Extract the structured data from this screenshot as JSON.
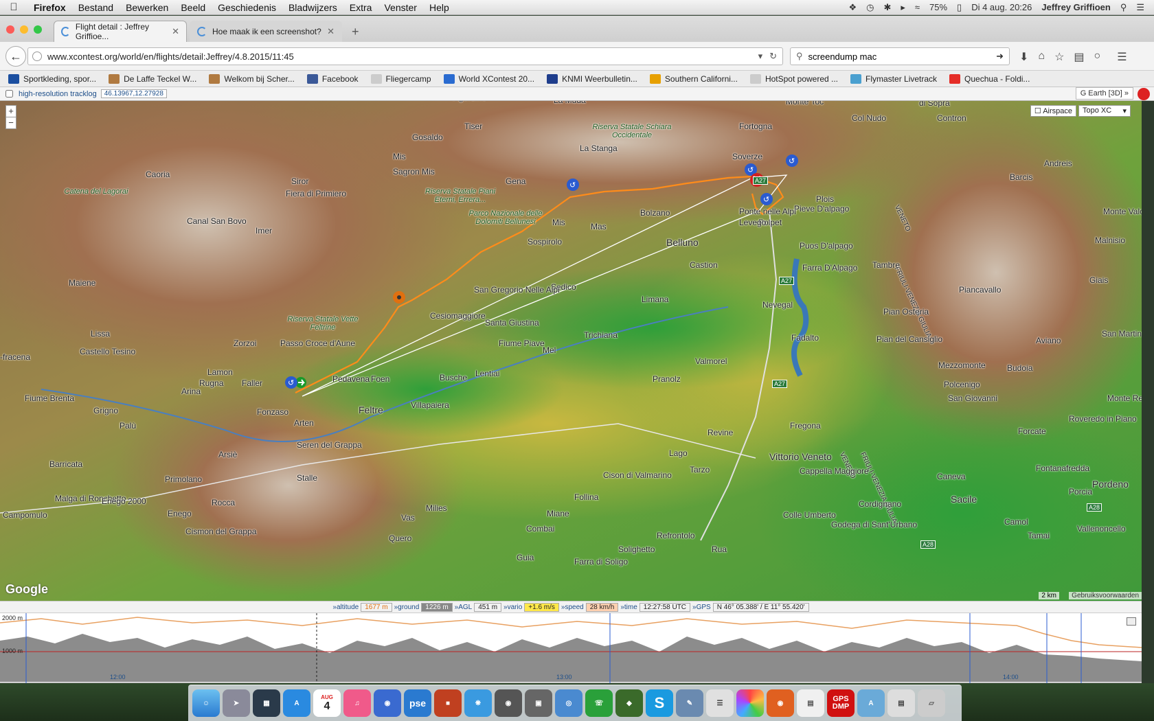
{
  "menubar": {
    "app": "Firefox",
    "items": [
      "Bestand",
      "Bewerken",
      "Beeld",
      "Geschiedenis",
      "Bladwijzers",
      "Extra",
      "Venster",
      "Help"
    ],
    "battery": "75%",
    "datetime": "Di 4 aug.  20:26",
    "user": "Jeffrey Griffioen"
  },
  "tabs": [
    {
      "title": "Flight detail : Jeffrey Griffioe...",
      "active": true
    },
    {
      "title": "Hoe maak ik een screenshot?",
      "active": false
    }
  ],
  "nav": {
    "url": "www.xcontest.org/world/en/flights/detail:Jeffrey/4.8.2015/11:45",
    "search": "screendump mac"
  },
  "bookmarks": [
    {
      "label": "Sportkleding, spor...",
      "color": "#1b4fa0"
    },
    {
      "label": "De Laffe Teckel W...",
      "color": "#b07a40"
    },
    {
      "label": "Welkom bij Scher...",
      "color": "#b07a40"
    },
    {
      "label": "Facebook",
      "color": "#3b5998"
    },
    {
      "label": "Fliegercamp",
      "color": "#cccccc"
    },
    {
      "label": "World XContest 20...",
      "color": "#2a6bd0"
    },
    {
      "label": "KNMI Weerbulletin...",
      "color": "#1e3d8c"
    },
    {
      "label": "Southern Californi...",
      "color": "#e7a000"
    },
    {
      "label": "HotSpot powered ...",
      "color": "#cccccc"
    },
    {
      "label": "Flymaster Livetrack",
      "color": "#4aa0d0"
    },
    {
      "label": "Quechua - Foldi...",
      "color": "#e52d27"
    }
  ],
  "toolstrip": {
    "checkbox_label": "high-resolution tracklog",
    "coords": "46.13967,12.27928",
    "gearth": "G Earth [3D] »"
  },
  "map": {
    "airspace": "Airspace",
    "layer": "Topo XC",
    "google": "Google",
    "scale": "2 km",
    "terms": "Gebruiksvoorwaarden",
    "zoom_in": "+",
    "zoom_out": "−",
    "labels": {
      "agordino": "Agordino",
      "la_muda": "La Muda",
      "monte_toc": "Monte Toc",
      "col_nudo": "Col Nudo",
      "di_sopra": "di Sopra",
      "contron": "Contron",
      "tiser": "Tiser",
      "gosaldo": "Gosaldo",
      "riserva_schiara": "Riserva Statale Schiara Occidentale",
      "la_stanga": "La Stanga",
      "fortogna": "Fortogna",
      "soverzene": "Soverze",
      "caoria": "Caoria",
      "mis": "Mis",
      "sagron_mis": "Sagron Mis",
      "siror": "Siror",
      "fiera": "Fiera di Primiero",
      "gena": "Gena",
      "riserva_piani": "Riserva Statale Piani Eterni, Errera...",
      "catena": "Catena del Lagorai",
      "canal": "Canal San Bovo",
      "imer": "Imer",
      "parco": "Parco Nazionale delle Dolomiti Bellunesi",
      "mis2": "Mis",
      "mas": "Mas",
      "bolzano": "Bolzano",
      "plois": "Plois",
      "pieve": "Pieve D'alpago",
      "barcis": "Barcis",
      "andreis": "Andreis",
      "friuli1": "FRIULI-VENEZIA GIULIA",
      "veneto1": "VENETO",
      "ponte": "Ponte nelle Alpi",
      "polpet": "Polpet",
      "levego": "Levego",
      "sospirolo": "Sospirolo",
      "belluno": "Belluno",
      "puos": "Puos D'alpago",
      "malnisio": "Malnisio",
      "montereale": "Monte Valcel",
      "maiene": "Maiene",
      "castion": "Castion",
      "farra": "Farra D'Alpago",
      "tambre": "Tambre",
      "sedico": "Sedico",
      "san_gregorio": "San Gregorio Nelle Alpi",
      "giais": "Giais",
      "piancavallo": "Piancavallo",
      "limana": "Limana",
      "nevegal": "Nevegal",
      "pian_osteria": "Pian Osteria",
      "lissa": "Lissa",
      "riserva_vette": "Riserva Statale Vette Feltrine",
      "cesiomaggiore": "Cesiomaggiore",
      "santa_giustina": "Santa Giustina",
      "trichiana": "Trichiana",
      "fadalto": "Fadalto",
      "pian_cansiglio": "Pian del Cansiglio",
      "aviano": "Aviano",
      "san_martino": "San Martino di Campagna",
      "castello_tesino": "Castello Tesino",
      "zorzoi": "Zorzoi",
      "passo_croce": "Passo Croce d'Aune",
      "fiume_piave": "Fiume Piave",
      "mel": "Mel",
      "valmorel": "Valmorel",
      "fracena": "-fracena",
      "lamon": "Lamon",
      "rugna": "Rugna",
      "faller": "Faller",
      "pedavena": "Pedavena",
      "foen": "Foen",
      "lentiai": "Lentiai",
      "busche": "Busche",
      "pranolz": "Pranolz",
      "mezzomonte": "Mezzomonte",
      "budoia": "Budoia",
      "polcenigo": "Polcenigo",
      "arina": "Arina",
      "fiume_brenta": "Fiume Brenta",
      "grigno": "Grigno",
      "fonzaso": "Fonzaso",
      "feltre": "Feltre",
      "villapaiera": "Villapaiera",
      "san_giovanni": "San Giovanni",
      "monte_reale": "Monte Re",
      "palu": "Palù",
      "arten": "Arten",
      "fregona": "Fregona",
      "friuli2": "FRIULI-VENEZIA GIULIA",
      "veneto2": "VENETO",
      "forcate": "Forcate",
      "roveredo": "Roveredo in Piano",
      "arsie": "Arsiè",
      "seren": "Seren del Grappa",
      "revine": "Revine",
      "lago": "Lago",
      "vittorio": "Vittorio Veneto",
      "barricata": "Barricata",
      "stalle": "Stalle",
      "tarzo": "Tarzo",
      "cappella": "Cappella Maggiore",
      "fontanafredda": "Fontanafredda",
      "primolano": "Primolano",
      "cison": "Cison di Valmarino",
      "caneva": "Caneva",
      "pordenone": "Pordeno",
      "malga": "Malga di Ronchetto",
      "enego2000": "Enego 2000",
      "rocca": "Rocca",
      "follina": "Follina",
      "cordignano": "Cordignano",
      "sacile": "Sacile",
      "porcia": "Porcia",
      "campomulo": "Campomulo",
      "enego": "Enego",
      "milies": "Milies",
      "miane": "Miane",
      "colle_umberto": "Colle Umberto",
      "vas": "Vas",
      "combai": "Combai",
      "refrontolo": "Refrontolo",
      "godega": "Godega di Sant'Urbano",
      "camol": "Camol",
      "vallenoncello": "Vallenoncello",
      "cismon": "Cismon del Grappa",
      "quero": "Quero",
      "solighetto": "Solighetto",
      "rua": "Rua",
      "tamai": "Tamai",
      "guia": "Guia",
      "farra_soligo": "Farra di Soligo",
      "a27a": "A27",
      "a27b": "A27",
      "a27c": "A27",
      "a28a": "A28",
      "a28b": "A28"
    }
  },
  "info": {
    "altitude_label": "»altitude",
    "altitude": "1677 m",
    "ground_label": "»ground",
    "ground": "1226 m",
    "agl_label": "»AGL",
    "agl": "451 m",
    "vario_label": "»vario",
    "vario": "+1.6 m/s",
    "speed_label": "»speed",
    "speed": "28 km/h",
    "time_label": "»time",
    "time": "12:27:58 UTC",
    "gps_label": "»GPS",
    "gps": "N 46° 05.388' / E 11° 55.420'"
  },
  "profile": {
    "y_labels": [
      "2000 m",
      "1000 m"
    ],
    "x_labels": [
      "12:00",
      "13:00",
      "14:00"
    ]
  },
  "dock": {
    "calendar_month": "AUG",
    "calendar_day": "4",
    "gps_label": "GPS DMP",
    "pse_label": "pse"
  },
  "colors": {
    "track": "#ff8c1a",
    "route": "#ffffff",
    "accent": "#1d4e89"
  }
}
